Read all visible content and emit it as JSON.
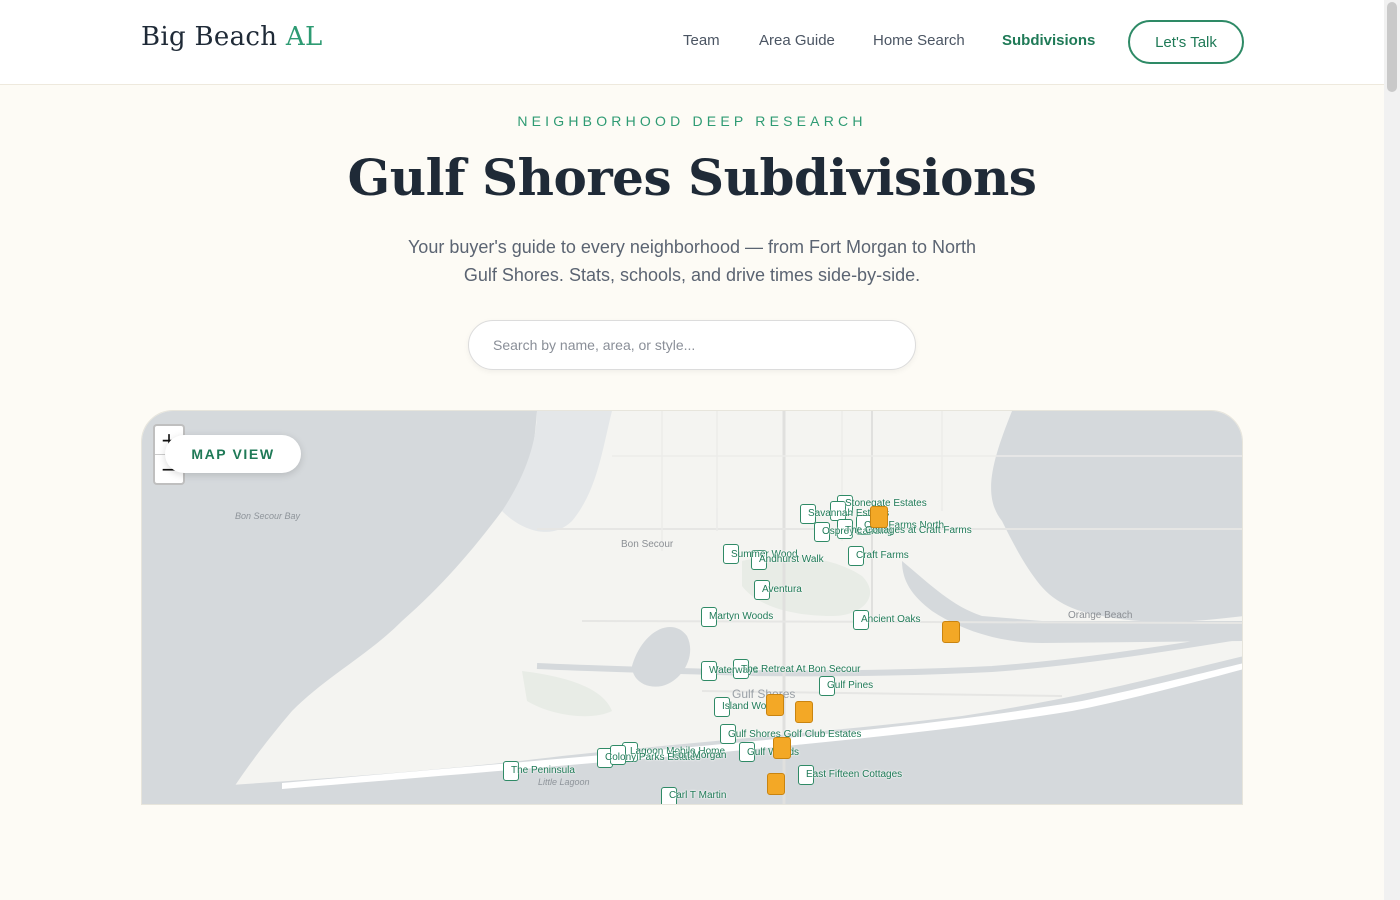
{
  "header": {
    "logo_main": "Big Beach",
    "logo_accent": "AL",
    "nav": [
      {
        "label": "Team"
      },
      {
        "label": "Area Guide"
      },
      {
        "label": "Home Search"
      },
      {
        "label": "Subdivisions",
        "active": true
      }
    ],
    "cta_label": "Let's Talk"
  },
  "hero": {
    "eyebrow": "NEIGHBORHOOD DEEP RESEARCH",
    "title": "Gulf Shores Subdivisions",
    "subtitle": "Your buyer's guide to every neighborhood — from Fort Morgan to North Gulf Shores. Stats, schools, and drive times side-by-side."
  },
  "search": {
    "placeholder": "Search by name, area, or style..."
  },
  "map": {
    "view_label": "MAP VIEW",
    "zoom_in": "+",
    "zoom_out": "−",
    "places": {
      "bon_secour_bay": "Bon Secour Bay",
      "bon_secour": "Bon Secour",
      "orange_beach": "Orange Beach",
      "gulf_shores": "Gulf Shores",
      "little_lagoon": "Little Lagoon"
    },
    "subdivisions": {
      "stonegate_estates": "Stonegate Estates",
      "savannah_estates": "Savannah Estates",
      "craft_farms_north": "Craft Farms North",
      "osprey_landing": "Osprey Landing",
      "the_cottages_craft_farms": "The Cottages at Craft Farms",
      "summer_wood": "Summer Wood",
      "andhurst_walk": "Andhurst Walk",
      "craft_farms": "Craft Farms",
      "aventura": "Aventura",
      "martyn_woods": "Martyn Woods",
      "ancient_oaks": "Ancient Oaks",
      "waterways": "Waterways",
      "retreat_bon_secour": "The Retreat At Bon Secour",
      "gulf_pines": "Gulf Pines",
      "island_woods": "Island Woods",
      "golf_club_estates": "Gulf Shores Golf Club Estates",
      "lagoon_mobile_home": "Lagoon Mobile Home",
      "colony_parks": "Colony Parks Estates",
      "fort_morgan": "Fort Morgan",
      "gulf_woods": "Gulf Woods",
      "the_peninsula": "The Peninsula",
      "east_fifteen": "East Fifteen Cottages",
      "carl_t_martin": "Carl T Martin"
    }
  },
  "colors": {
    "brand_green": "#2e9b73",
    "brand_dark_green": "#1f7a57",
    "background": "#fdfbf5",
    "amenity_orange": "#f3a826"
  },
  "icons": [
    "plus-icon",
    "minus-icon",
    "amenity-marker-icon"
  ]
}
